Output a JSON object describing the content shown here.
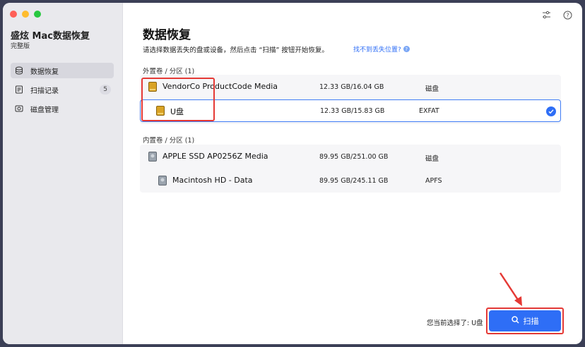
{
  "app": {
    "title": "盛炫 Mac数据恢复",
    "edition": "完整版"
  },
  "sidebar": {
    "items": [
      {
        "label": "数据恢复",
        "icon": "data-recovery-icon",
        "active": true
      },
      {
        "label": "扫描记录",
        "icon": "scan-history-icon",
        "badge": "5"
      },
      {
        "label": "磁盘管理",
        "icon": "disk-management-icon"
      }
    ]
  },
  "main": {
    "title": "数据恢复",
    "subtitle": "请选择数据丢失的盘或设备，然后点击 “扫描” 按钮开始恢复。",
    "help_link": "找不到丢失位置?",
    "external_label": "外置卷 / 分区 (1)",
    "internal_label": "内置卷 / 分区 (1)",
    "external": [
      {
        "name": "VendorCo ProductCode Media",
        "size": "12.33 GB/16.04 GB",
        "fs": "磁盘",
        "icon": "external-disk-icon"
      },
      {
        "name": "U盘",
        "size": "12.33 GB/15.83 GB",
        "fs": "EXFAT",
        "icon": "usb-volume-icon",
        "selected": true
      }
    ],
    "internal": [
      {
        "name": "APPLE SSD AP0256Z Media",
        "size": "89.95 GB/251.00 GB",
        "fs": "磁盘",
        "icon": "internal-disk-icon"
      },
      {
        "name": "Macintosh HD - Data",
        "size": "89.95 GB/245.11 GB",
        "fs": "APFS",
        "icon": "internal-volume-icon"
      }
    ],
    "footer": {
      "selected_text": "您当前选择了: U盘",
      "scan_label": "扫描"
    }
  },
  "colors": {
    "accent": "#2e6ef6",
    "annotation": "#e53935",
    "sidebar_bg": "#e9e9ed"
  }
}
